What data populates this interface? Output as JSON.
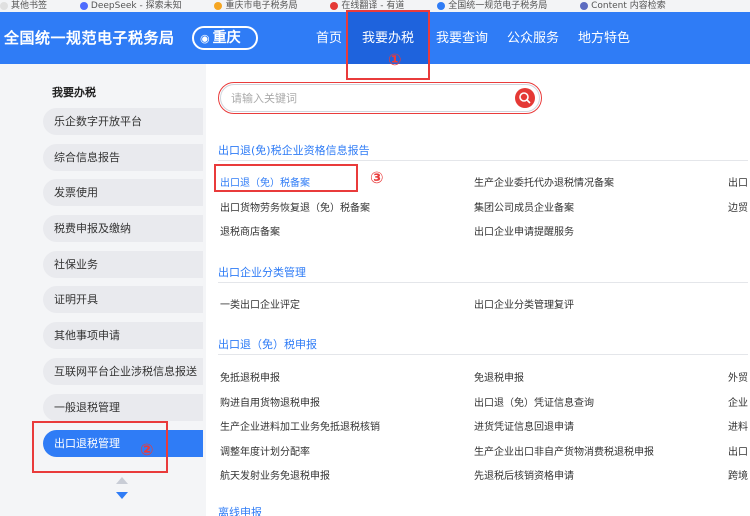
{
  "bookmarks": [
    {
      "label": "其他书签",
      "color": "#e0e0e0"
    },
    {
      "label": "DeepSeek - 探索未知",
      "color": "#4d6bfe"
    },
    {
      "label": "重庆市电子税务局",
      "color": "#f5a623"
    },
    {
      "label": "在线翻译 - 有道",
      "color": "#e53935"
    },
    {
      "label": "全国统一规范电子税务局",
      "color": "#2f7cf6"
    },
    {
      "label": "Content 内容检索",
      "color": "#5c6bc0"
    }
  ],
  "header": {
    "title": "全国统一规范电子税务局",
    "city": "重庆",
    "nav": [
      "首页",
      "我要办税",
      "我要查询",
      "公众服务",
      "地方特色"
    ],
    "active_nav": "我要办税"
  },
  "annotations": {
    "n1": "①",
    "n2": "②",
    "n3": "③"
  },
  "sidebar": {
    "heading": "我要办税",
    "items": [
      "乐企数字开放平台",
      "综合信息报告",
      "发票使用",
      "税费申报及缴纳",
      "社保业务",
      "证明开具",
      "其他事项申请",
      "互联网平台企业涉税信息报送",
      "一般退税管理",
      "出口退税管理"
    ],
    "active_index": 9
  },
  "search": {
    "placeholder": "请输入关键词"
  },
  "sections": [
    {
      "title": "出口退(免)税企业资格信息报告",
      "rows": [
        [
          "出口退（免）税备案",
          "生产企业委托代办退税情况备案",
          "出口"
        ],
        [
          "出口货物劳务恢复退（免）税备案",
          "集团公司成员企业备案",
          "边贸"
        ],
        [
          "退税商店备案",
          "出口企业申请提醒服务",
          ""
        ]
      ]
    },
    {
      "title": "出口企业分类管理",
      "rows": [
        [
          "一类出口企业评定",
          "出口企业分类管理复评",
          ""
        ]
      ]
    },
    {
      "title": "出口退（免）税申报",
      "rows": [
        [
          "免抵退税申报",
          "免退税申报",
          "外贸"
        ],
        [
          "购进自用货物退税申报",
          "出口退（免）凭证信息查询",
          "企业"
        ],
        [
          "生产企业进料加工业务免抵退税核销",
          "进货凭证信息回退申请",
          "进料"
        ],
        [
          "调整年度计划分配率",
          "生产企业出口非自产货物消费税退税申报",
          "出口"
        ],
        [
          "航天发射业务免退税申报",
          "先退税后核销资格申请",
          "跨境"
        ]
      ]
    }
  ],
  "more_section": "离线申报"
}
